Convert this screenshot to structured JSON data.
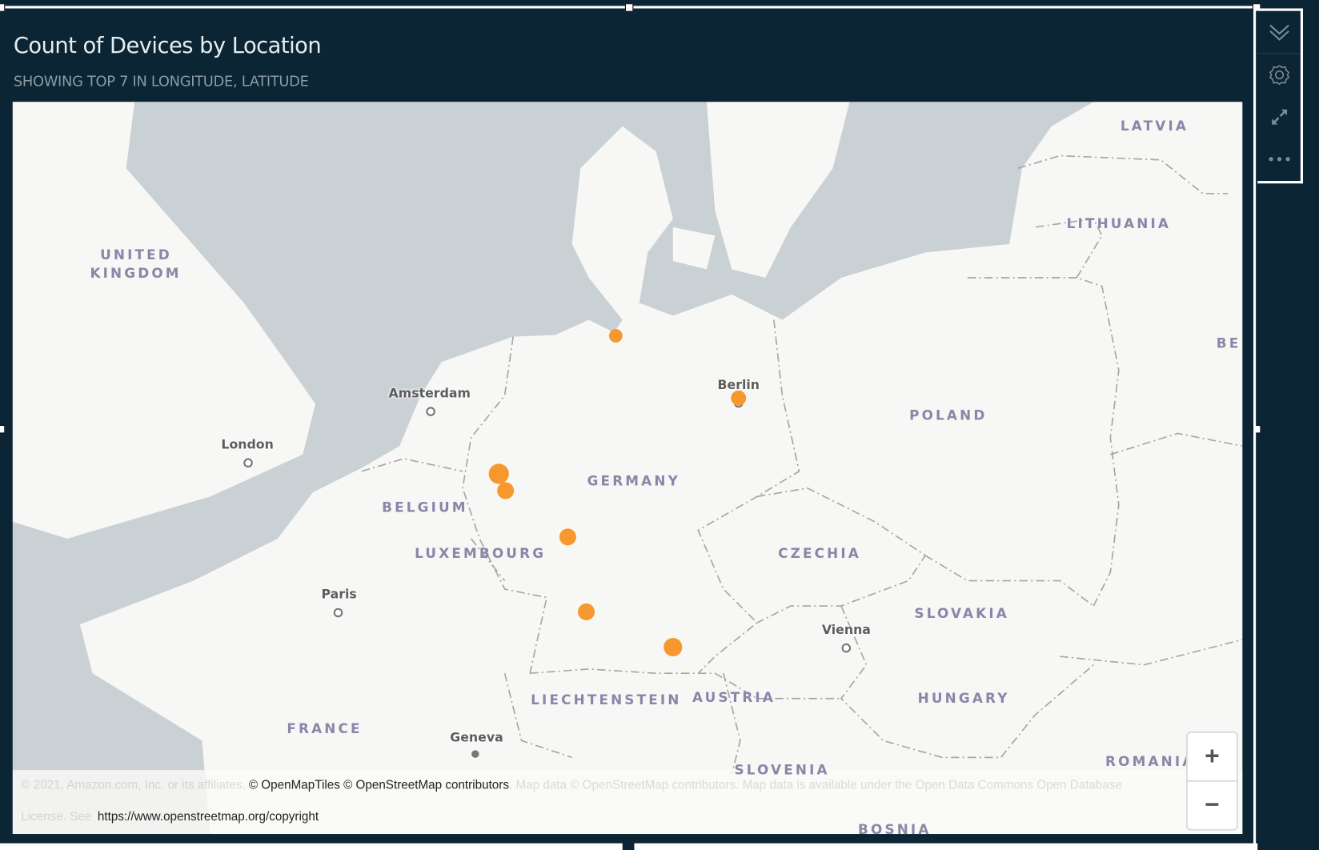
{
  "visual": {
    "title": "Count of Devices by Location",
    "subtitle": "SHOWING TOP 7 IN LONGITUDE, LATITUDE"
  },
  "toolbar": {
    "icons": [
      "chevron-double-down-icon",
      "gear-icon",
      "expand-icon",
      "more-icon"
    ]
  },
  "map": {
    "countries": [
      "LATVIA",
      "LITHUANIA",
      "UNITED",
      "KINGDOM",
      "BE",
      "POLAND",
      "GERMANY",
      "BELGIUM",
      "LUXEMBOURG",
      "CZECHIA",
      "SLOVAKIA",
      "AUSTRIA",
      "HUNGARY",
      "LIECHTENSTEIN",
      "FRANCE",
      "SLOVENIA",
      "ROMANIA",
      "BOSNIA"
    ],
    "cities": [
      "Amsterdam",
      "London",
      "Berlin",
      "Paris",
      "Vienna",
      "Geneva"
    ],
    "marker_color": "#f7982f",
    "points_count": 7,
    "attribution": {
      "faded_prefix": "© 2021, Amazon.com, Inc. or its affiliates. ",
      "main": "© OpenMapTiles © OpenStreetMap contributors",
      "faded_suffix": ". Map data © OpenStreetMap contributors. Map data is available under the Open Data Commons Open Database",
      "faded_line2": "License. See ",
      "link": "https://www.openstreetmap.org/copyright"
    },
    "zoom_in": "+",
    "zoom_out": "−"
  }
}
